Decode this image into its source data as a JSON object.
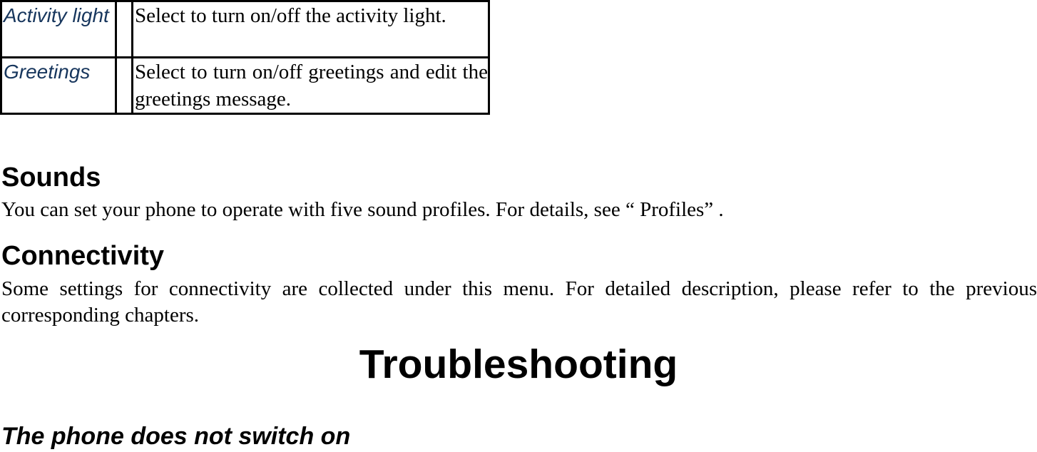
{
  "table": {
    "rows": [
      {
        "term": "Activity light",
        "description": "Select to turn on/off the activity light."
      },
      {
        "term": "Greetings",
        "description": "Select to turn on/off greetings and edit the greetings message."
      }
    ]
  },
  "sections": {
    "sounds": {
      "heading": "Sounds",
      "body": "You can set your phone to operate with five sound profiles. For details, see “ Profiles” ."
    },
    "connectivity": {
      "heading": "Connectivity",
      "body": "Some settings for connectivity are collected under this menu. For detailed description, please refer to the previous corresponding chapters."
    }
  },
  "chapter": {
    "title": "Troubleshooting",
    "subheading": "The phone does not switch on"
  },
  "colors": {
    "term_text": "#17365d"
  }
}
